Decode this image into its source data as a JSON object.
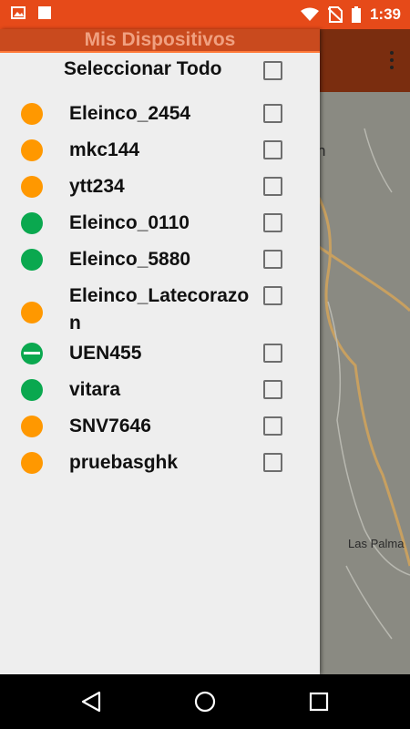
{
  "status_bar": {
    "time": "1:39",
    "icons": [
      "image-icon",
      "square-icon",
      "wifi-icon",
      "no-sim-icon",
      "battery-icon"
    ]
  },
  "app": {
    "map_labels": [
      "Las Palma",
      "n"
    ]
  },
  "drawer": {
    "title": "Mis Dispositivos",
    "select_all_label": "Seleccionar Todo",
    "devices": [
      {
        "name": "Eleinco_2454",
        "status": "orange"
      },
      {
        "name": "mkc144",
        "status": "orange"
      },
      {
        "name": "ytt234",
        "status": "orange"
      },
      {
        "name": "Eleinco_0110",
        "status": "green"
      },
      {
        "name": "Eleinco_5880",
        "status": "green"
      },
      {
        "name": "Eleinco_Latecorazon",
        "status": "orange"
      },
      {
        "name": "UEN455",
        "status": "green-bar"
      },
      {
        "name": "vitara",
        "status": "green"
      },
      {
        "name": "SNV7646",
        "status": "orange"
      },
      {
        "name": "pruebasghk",
        "status": "orange"
      }
    ]
  },
  "colors": {
    "status_bar": "#e64a19",
    "drawer_header": "#c94a1e",
    "orange": "#ff9800",
    "green": "#0aa84f"
  }
}
